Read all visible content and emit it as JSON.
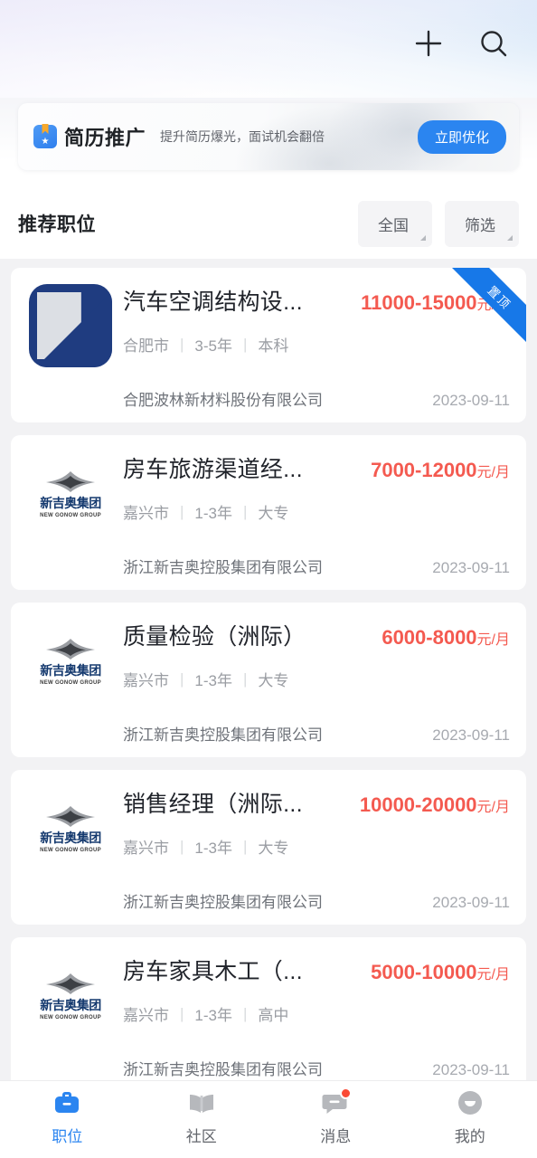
{
  "header": {
    "add_icon": "plus-icon",
    "search_icon": "search-icon"
  },
  "banner": {
    "icon": "resume-badge-icon",
    "title": "简历推广",
    "subtitle": "提升简历爆光，面试机会翻倍",
    "cta_label": "立即优化",
    "cta_color": "#2b85f0"
  },
  "section": {
    "title": "推荐职位",
    "filters": [
      {
        "label": "全国",
        "name": "region-filter"
      },
      {
        "label": "筛选",
        "name": "sort-filter"
      }
    ]
  },
  "jobs": [
    {
      "title": "汽车空调结构设...",
      "salary": "11000-15000",
      "salary_unit": "元/月",
      "city": "合肥市",
      "experience": "3-5年",
      "education": "本科",
      "company": "合肥波林新材料股份有限公司",
      "date": "2023-09-11",
      "logo": "bolin-logo",
      "ribbon": "置顶"
    },
    {
      "title": "房车旅游渠道经...",
      "salary": "7000-12000",
      "salary_unit": "元/月",
      "city": "嘉兴市",
      "experience": "1-3年",
      "education": "大专",
      "company": "浙江新吉奥控股集团有限公司",
      "date": "2023-09-11",
      "logo": "gonow-logo",
      "ribbon": ""
    },
    {
      "title": "质量检验（洲际）",
      "salary": "6000-8000",
      "salary_unit": "元/月",
      "city": "嘉兴市",
      "experience": "1-3年",
      "education": "大专",
      "company": "浙江新吉奥控股集团有限公司",
      "date": "2023-09-11",
      "logo": "gonow-logo",
      "ribbon": ""
    },
    {
      "title": "销售经理（洲际...",
      "salary": "10000-20000",
      "salary_unit": "元/月",
      "city": "嘉兴市",
      "experience": "1-3年",
      "education": "大专",
      "company": "浙江新吉奥控股集团有限公司",
      "date": "2023-09-11",
      "logo": "gonow-logo",
      "ribbon": ""
    },
    {
      "title": "房车家具木工（...",
      "salary": "5000-10000",
      "salary_unit": "元/月",
      "city": "嘉兴市",
      "experience": "1-3年",
      "education": "高中",
      "company": "浙江新吉奥控股集团有限公司",
      "date": "2023-09-11",
      "logo": "gonow-logo",
      "ribbon": ""
    }
  ],
  "logo_text": {
    "gonow_cn": "新吉奥集团",
    "gonow_en": "NEW GONOW GROUP"
  },
  "tabbar": {
    "active_color": "#2b85f0",
    "items": [
      {
        "label": "职位",
        "icon": "briefcase-icon",
        "active": true,
        "badge": false
      },
      {
        "label": "社区",
        "icon": "book-icon",
        "active": false,
        "badge": false
      },
      {
        "label": "消息",
        "icon": "chat-icon",
        "active": false,
        "badge": true
      },
      {
        "label": "我的",
        "icon": "avatar-icon",
        "active": false,
        "badge": false
      }
    ]
  }
}
